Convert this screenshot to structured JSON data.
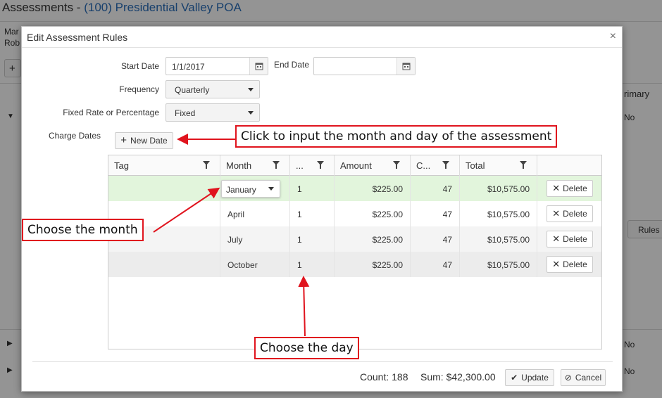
{
  "background": {
    "title_prefix": "Assessments - ",
    "title_link": "(100) Presidential Valley POA",
    "frag_top_1": "Mar",
    "frag_top_2": "Rob",
    "frag_plus": "+",
    "frag_primary": "rimary",
    "frag_no_1": "No",
    "frag_no_2": "No",
    "frag_no_3": "No",
    "frag_rules": "Rules"
  },
  "modal": {
    "title": "Edit Assessment Rules",
    "close": "×"
  },
  "form": {
    "start_date_label": "Start Date",
    "start_date_value": "1/1/2017",
    "end_date_label": "End Date",
    "end_date_value": "",
    "frequency_label": "Frequency",
    "frequency_value": "Quarterly",
    "rate_label": "Fixed Rate or Percentage",
    "rate_value": "Fixed",
    "charge_dates_label": "Charge Dates",
    "new_date_button": "New Date"
  },
  "grid": {
    "columns": [
      "Tag",
      "Month",
      "...",
      "Amount",
      "C...",
      "Total",
      ""
    ],
    "rows": [
      {
        "tag": "",
        "month": "January",
        "day": "1",
        "amount": "$225.00",
        "count": "47",
        "total": "$10,575.00",
        "action": "Delete"
      },
      {
        "tag": "",
        "month": "April",
        "day": "1",
        "amount": "$225.00",
        "count": "47",
        "total": "$10,575.00",
        "action": "Delete"
      },
      {
        "tag": "",
        "month": "July",
        "day": "1",
        "amount": "$225.00",
        "count": "47",
        "total": "$10,575.00",
        "action": "Delete"
      },
      {
        "tag": "",
        "month": "October",
        "day": "1",
        "amount": "$225.00",
        "count": "47",
        "total": "$10,575.00",
        "action": "Delete"
      }
    ]
  },
  "footer": {
    "count": "Count: 188",
    "sum": "Sum: $42,300.00",
    "update_button": "Update",
    "cancel_button": "Cancel"
  },
  "annotations": {
    "new_date_note": "Click to input the month and day of the assessment",
    "month_note": "Choose the month",
    "day_note": "Choose the day",
    "color": "#e0141e"
  }
}
